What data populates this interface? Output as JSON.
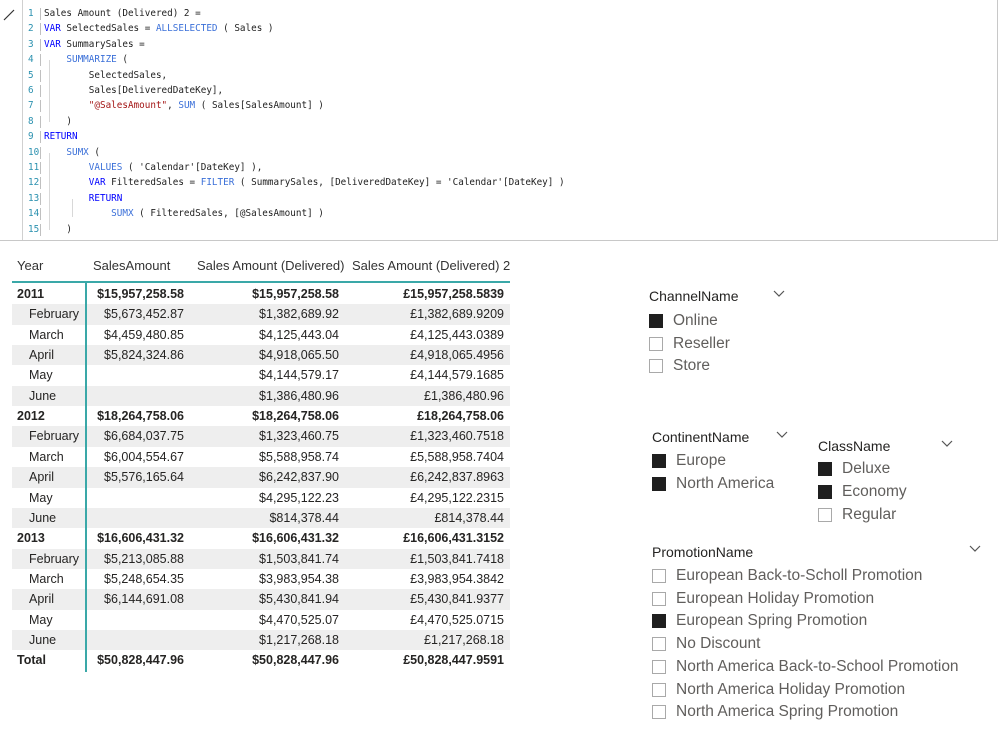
{
  "editor": {
    "lines": [
      {
        "n": "1",
        "parts": [
          [
            "t",
            "Sales Amount (Delivered) 2 ="
          ]
        ]
      },
      {
        "n": "2",
        "parts": [
          [
            "k",
            "VAR "
          ],
          [
            "t",
            "SelectedSales = "
          ],
          [
            "f",
            "ALLSELECTED"
          ],
          [
            "t",
            " ( Sales )"
          ]
        ]
      },
      {
        "n": "3",
        "parts": [
          [
            "k",
            "VAR "
          ],
          [
            "t",
            "SummarySales ="
          ]
        ]
      },
      {
        "n": "4",
        "parts": [
          [
            "t",
            "    "
          ],
          [
            "f",
            "SUMMARIZE"
          ],
          [
            "t",
            " ("
          ]
        ]
      },
      {
        "n": "5",
        "parts": [
          [
            "t",
            "        SelectedSales,"
          ]
        ]
      },
      {
        "n": "6",
        "parts": [
          [
            "t",
            "        Sales[DeliveredDateKey],"
          ]
        ]
      },
      {
        "n": "7",
        "parts": [
          [
            "t",
            "        "
          ],
          [
            "s",
            "\"@SalesAmount\""
          ],
          [
            "t",
            ", "
          ],
          [
            "f",
            "SUM"
          ],
          [
            "t",
            " ( Sales[SalesAmount] )"
          ]
        ]
      },
      {
        "n": "8",
        "parts": [
          [
            "t",
            "    )"
          ]
        ]
      },
      {
        "n": "9",
        "parts": [
          [
            "k",
            "RETURN"
          ]
        ]
      },
      {
        "n": "10",
        "parts": [
          [
            "t",
            "    "
          ],
          [
            "f",
            "SUMX"
          ],
          [
            "t",
            " ("
          ]
        ]
      },
      {
        "n": "11",
        "parts": [
          [
            "t",
            "        "
          ],
          [
            "f",
            "VALUES"
          ],
          [
            "t",
            " ( 'Calendar'[DateKey] ),"
          ]
        ]
      },
      {
        "n": "12",
        "parts": [
          [
            "t",
            "        "
          ],
          [
            "k",
            "VAR "
          ],
          [
            "t",
            "FilteredSales = "
          ],
          [
            "f",
            "FILTER"
          ],
          [
            "t",
            " ( SummarySales, [DeliveredDateKey] = 'Calendar'[DateKey] )"
          ]
        ]
      },
      {
        "n": "13",
        "parts": [
          [
            "t",
            "        "
          ],
          [
            "k",
            "RETURN"
          ]
        ]
      },
      {
        "n": "14",
        "parts": [
          [
            "t",
            "            "
          ],
          [
            "f",
            "SUMX"
          ],
          [
            "t",
            " ( FilteredSales, [@SalesAmount] )"
          ]
        ]
      },
      {
        "n": "15",
        "parts": [
          [
            "t",
            "    )"
          ]
        ]
      }
    ]
  },
  "matrix": {
    "headers": [
      "Year",
      "SalesAmount",
      "Sales Amount (Delivered)",
      "Sales Amount (Delivered) 2"
    ],
    "rows": [
      {
        "type": "year",
        "cells": [
          "2011",
          "$15,957,258.58",
          "$15,957,258.58",
          "£15,957,258.5839"
        ]
      },
      {
        "type": "month",
        "cells": [
          "February",
          "$5,673,452.87",
          "$1,382,689.92",
          "£1,382,689.9209"
        ]
      },
      {
        "type": "month",
        "cells": [
          "March",
          "$4,459,480.85",
          "$4,125,443.04",
          "£4,125,443.0389"
        ]
      },
      {
        "type": "month",
        "cells": [
          "April",
          "$5,824,324.86",
          "$4,918,065.50",
          "£4,918,065.4956"
        ]
      },
      {
        "type": "month",
        "cells": [
          "May",
          "",
          "$4,144,579.17",
          "£4,144,579.1685"
        ]
      },
      {
        "type": "month",
        "cells": [
          "June",
          "",
          "$1,386,480.96",
          "£1,386,480.96"
        ]
      },
      {
        "type": "year",
        "cells": [
          "2012",
          "$18,264,758.06",
          "$18,264,758.06",
          "£18,264,758.06"
        ]
      },
      {
        "type": "month",
        "cells": [
          "February",
          "$6,684,037.75",
          "$1,323,460.75",
          "£1,323,460.7518"
        ]
      },
      {
        "type": "month",
        "cells": [
          "March",
          "$6,004,554.67",
          "$5,588,958.74",
          "£5,588,958.7404"
        ]
      },
      {
        "type": "month",
        "cells": [
          "April",
          "$5,576,165.64",
          "$6,242,837.90",
          "£6,242,837.8963"
        ]
      },
      {
        "type": "month",
        "cells": [
          "May",
          "",
          "$4,295,122.23",
          "£4,295,122.2315"
        ]
      },
      {
        "type": "month",
        "cells": [
          "June",
          "",
          "$814,378.44",
          "£814,378.44"
        ]
      },
      {
        "type": "year",
        "cells": [
          "2013",
          "$16,606,431.32",
          "$16,606,431.32",
          "£16,606,431.3152"
        ]
      },
      {
        "type": "month",
        "cells": [
          "February",
          "$5,213,085.88",
          "$1,503,841.74",
          "£1,503,841.7418"
        ]
      },
      {
        "type": "month",
        "cells": [
          "March",
          "$5,248,654.35",
          "$3,983,954.38",
          "£3,983,954.3842"
        ]
      },
      {
        "type": "month",
        "cells": [
          "April",
          "$6,144,691.08",
          "$5,430,841.94",
          "£5,430,841.9377"
        ]
      },
      {
        "type": "month",
        "cells": [
          "May",
          "",
          "$4,470,525.07",
          "£4,470,525.0715"
        ]
      },
      {
        "type": "month",
        "cells": [
          "June",
          "",
          "$1,217,268.18",
          "£1,217,268.18"
        ]
      },
      {
        "type": "total",
        "cells": [
          "Total",
          "$50,828,447.96",
          "$50,828,447.96",
          "£50,828,447.9591"
        ]
      }
    ]
  },
  "slicers": {
    "channel": {
      "title": "ChannelName",
      "items": [
        {
          "label": "Online",
          "checked": true
        },
        {
          "label": "Reseller",
          "checked": false
        },
        {
          "label": "Store",
          "checked": false
        }
      ]
    },
    "continent": {
      "title": "ContinentName",
      "items": [
        {
          "label": "Europe",
          "checked": true
        },
        {
          "label": "North America",
          "checked": true
        }
      ]
    },
    "class": {
      "title": "ClassName",
      "items": [
        {
          "label": "Deluxe",
          "checked": true
        },
        {
          "label": "Economy",
          "checked": true
        },
        {
          "label": "Regular",
          "checked": false
        }
      ]
    },
    "promotion": {
      "title": "PromotionName",
      "items": [
        {
          "label": "European Back-to-Scholl Promotion",
          "checked": false
        },
        {
          "label": "European Holiday Promotion",
          "checked": false
        },
        {
          "label": "European Spring Promotion",
          "checked": true
        },
        {
          "label": "No Discount",
          "checked": false
        },
        {
          "label": "North America Back-to-School Promotion",
          "checked": false
        },
        {
          "label": "North America Holiday Promotion",
          "checked": false
        },
        {
          "label": "North America Spring Promotion",
          "checked": false
        }
      ]
    }
  }
}
